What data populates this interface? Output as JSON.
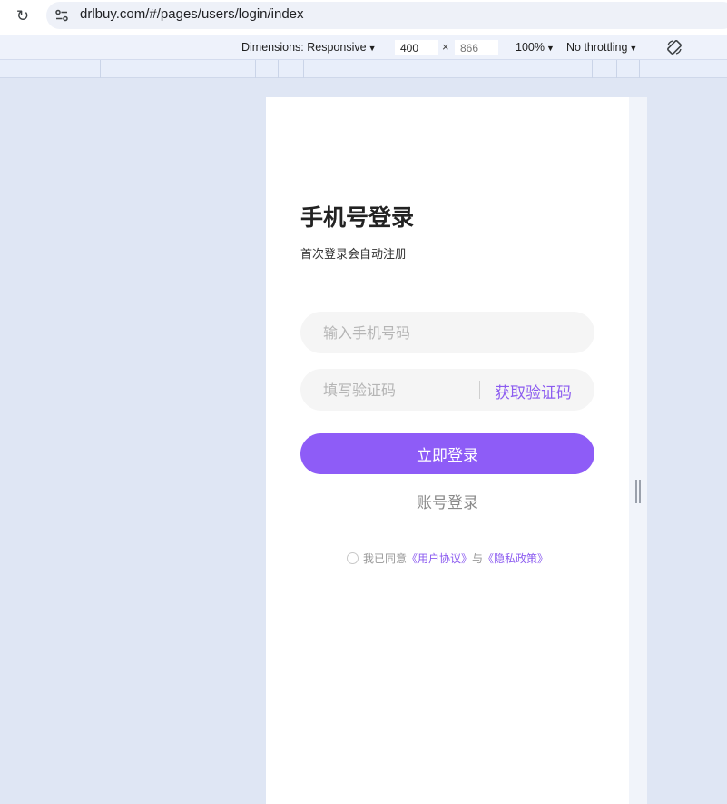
{
  "browser": {
    "url": "drlbuy.com/#/pages/users/login/index"
  },
  "devtools": {
    "dimensions_label": "Dimensions: Responsive",
    "width_value": "400",
    "height_value": "866",
    "times": "×",
    "zoom": "100%",
    "throttling": "No throttling"
  },
  "page": {
    "title": "手机号登录",
    "subtitle": "首次登录会自动注册",
    "phone_placeholder": "输入手机号码",
    "code_placeholder": "填写验证码",
    "get_code_label": "获取验证码",
    "login_button": "立即登录",
    "account_login": "账号登录",
    "agree_prefix": "我已同意",
    "user_agreement": "《用户协议》",
    "agree_and": "与",
    "privacy_policy": "《隐私政策》"
  },
  "colors": {
    "accent": "#8e5cf7",
    "link": "#8c5cf0"
  }
}
